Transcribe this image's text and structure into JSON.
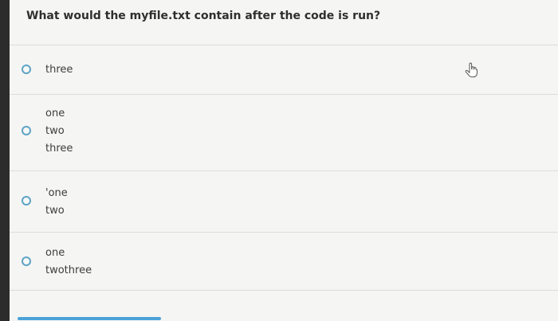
{
  "question": {
    "text": "What would the myfile.txt contain after the code is run?"
  },
  "options": [
    {
      "lines": [
        "three"
      ]
    },
    {
      "lines": [
        "one",
        "two",
        "three"
      ]
    },
    {
      "lines": [
        "'one",
        "two"
      ]
    },
    {
      "lines": [
        "one",
        "twothree"
      ]
    }
  ],
  "colors": {
    "radio_border": "#5da3c7",
    "accent_bar": "#4aa3d8"
  },
  "icons": {
    "cursor": "hand-pointer-icon"
  }
}
